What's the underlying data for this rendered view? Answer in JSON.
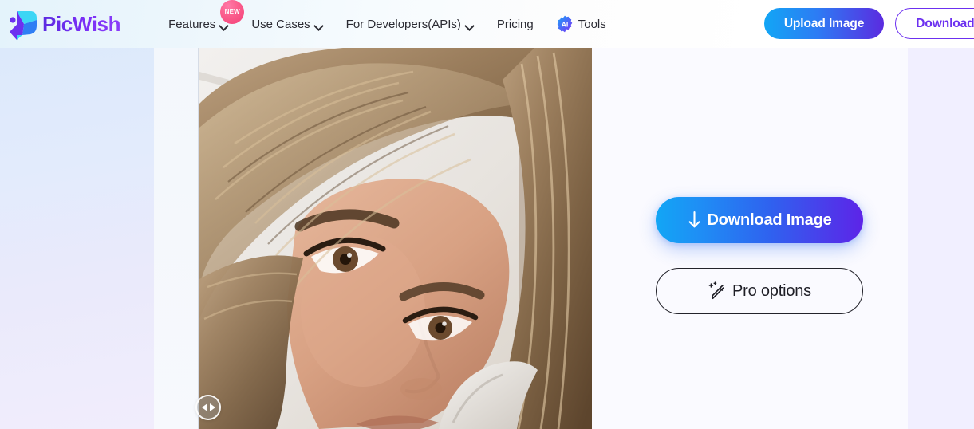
{
  "header": {
    "brand": {
      "name": "PicWish",
      "logo_icon": "picwish-logo-icon",
      "logo_colors": [
        "#3dd6f5",
        "#6c30f0",
        "#2f7ef4"
      ]
    },
    "nav": [
      {
        "label": "Features",
        "has_dropdown": true,
        "badge": "NEW",
        "icon": null
      },
      {
        "label": "Use Cases",
        "has_dropdown": true,
        "badge": null,
        "icon": null
      },
      {
        "label": "For Developers(APIs)",
        "has_dropdown": true,
        "badge": null,
        "icon": null
      },
      {
        "label": "Pricing",
        "has_dropdown": false,
        "badge": null,
        "icon": null
      },
      {
        "label": "Tools",
        "has_dropdown": false,
        "badge": null,
        "icon": "ai-chip-icon",
        "icon_text": "AI"
      }
    ],
    "actions": {
      "upload_label": "Upload Image",
      "download_app_label": "Download App"
    },
    "colors": {
      "brand_purple": "#6c30f0",
      "accent_cyan": "#12a6f5",
      "badge_pink": "#f43f77"
    }
  },
  "editor": {
    "image": {
      "alt": "portrait photo of a woman with long blonde-brown hair",
      "compare_handle_icon": "compare-slider-handle-icon"
    },
    "buttons": {
      "download_image_label": "Download Image",
      "download_icon": "download-arrow-icon",
      "pro_options_label": "Pro options",
      "pro_options_icon": "magic-pencil-icon"
    }
  }
}
